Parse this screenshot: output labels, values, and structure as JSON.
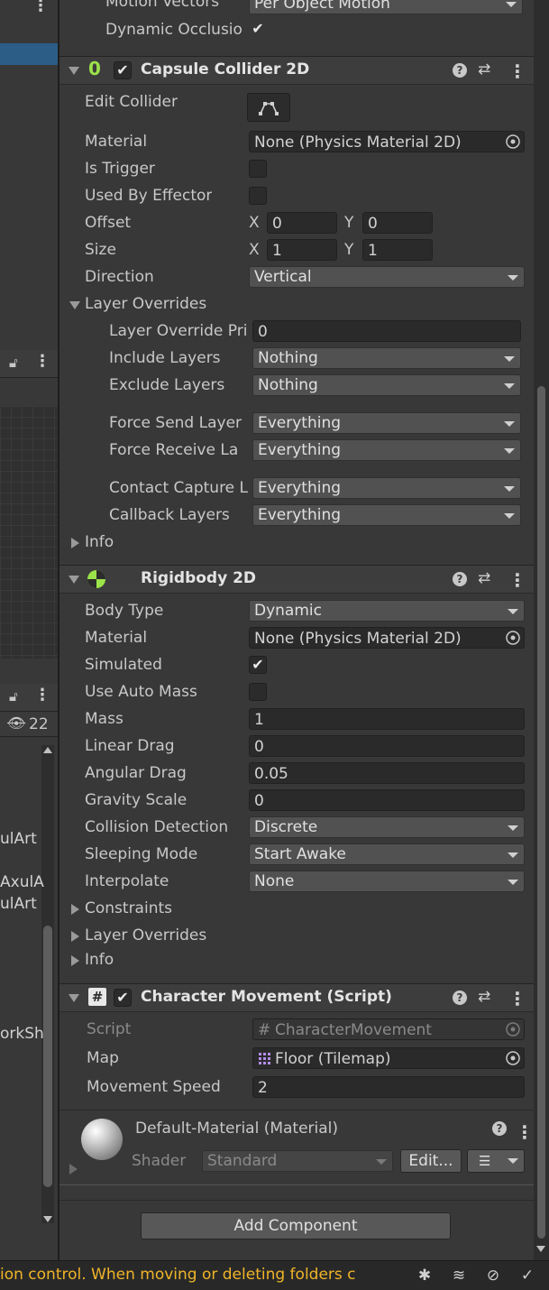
{
  "left_panel": {
    "hierarchy_items": [
      "ulArt",
      "AxulA",
      "ulArt",
      "orkSh"
    ],
    "visibility_count": "22"
  },
  "top_rows": {
    "motion_vectors": {
      "label": "Motion Vectors",
      "value": "Per Object Motion"
    },
    "dynamic_occlusion": {
      "label": "Dynamic Occlusio",
      "checked": true
    }
  },
  "capsule_collider": {
    "title": "Capsule Collider 2D",
    "enabled": true,
    "edit_collider_label": "Edit Collider",
    "material": {
      "label": "Material",
      "value": "None (Physics Material 2D)"
    },
    "is_trigger": {
      "label": "Is Trigger",
      "checked": false
    },
    "used_by_effector": {
      "label": "Used By Effector",
      "checked": false
    },
    "offset": {
      "label": "Offset",
      "x_label": "X",
      "x": "0",
      "y_label": "Y",
      "y": "0"
    },
    "size": {
      "label": "Size",
      "x_label": "X",
      "x": "1",
      "y_label": "Y",
      "y": "1"
    },
    "direction": {
      "label": "Direction",
      "value": "Vertical"
    },
    "layer_overrides": {
      "label": "Layer Overrides",
      "priority": {
        "label": "Layer Override Pri",
        "value": "0"
      },
      "include_layers": {
        "label": "Include Layers",
        "value": "Nothing"
      },
      "exclude_layers": {
        "label": "Exclude Layers",
        "value": "Nothing"
      },
      "force_send": {
        "label": "Force Send Layer",
        "value": "Everything"
      },
      "force_receive": {
        "label": "Force Receive La",
        "value": "Everything"
      },
      "contact_capture": {
        "label": "Contact Capture L",
        "value": "Everything"
      },
      "callback_layers": {
        "label": "Callback Layers",
        "value": "Everything"
      }
    },
    "info_label": "Info"
  },
  "rigidbody": {
    "title": "Rigidbody 2D",
    "body_type": {
      "label": "Body Type",
      "value": "Dynamic"
    },
    "material": {
      "label": "Material",
      "value": "None (Physics Material 2D)"
    },
    "simulated": {
      "label": "Simulated",
      "checked": true
    },
    "use_auto_mass": {
      "label": "Use Auto Mass",
      "checked": false
    },
    "mass": {
      "label": "Mass",
      "value": "1"
    },
    "linear_drag": {
      "label": "Linear Drag",
      "value": "0"
    },
    "angular_drag": {
      "label": "Angular Drag",
      "value": "0.05"
    },
    "gravity_scale": {
      "label": "Gravity Scale",
      "value": "0"
    },
    "collision_detection": {
      "label": "Collision Detection",
      "value": "Discrete"
    },
    "sleeping_mode": {
      "label": "Sleeping Mode",
      "value": "Start Awake"
    },
    "interpolate": {
      "label": "Interpolate",
      "value": "None"
    },
    "constraints_label": "Constraints",
    "layer_overrides_label": "Layer Overrides",
    "info_label": "Info"
  },
  "character_movement": {
    "title": "Character Movement (Script)",
    "enabled": true,
    "script": {
      "label": "Script",
      "value": "CharacterMovement"
    },
    "map": {
      "label": "Map",
      "value": "Floor (Tilemap)"
    },
    "movement_speed": {
      "label": "Movement Speed",
      "value": "2"
    }
  },
  "material_section": {
    "title": "Default-Material (Material)",
    "shader_label": "Shader",
    "shader_value": "Standard",
    "edit_label": "Edit..."
  },
  "add_component_label": "Add Component",
  "console": {
    "message": "ion control. When moving or deleting folders c"
  },
  "colors": {
    "background": "#383838",
    "field": "#2a2a2a",
    "accent_green": "#9be34a",
    "warning": "#f0b429",
    "selection": "#2c5d87"
  }
}
